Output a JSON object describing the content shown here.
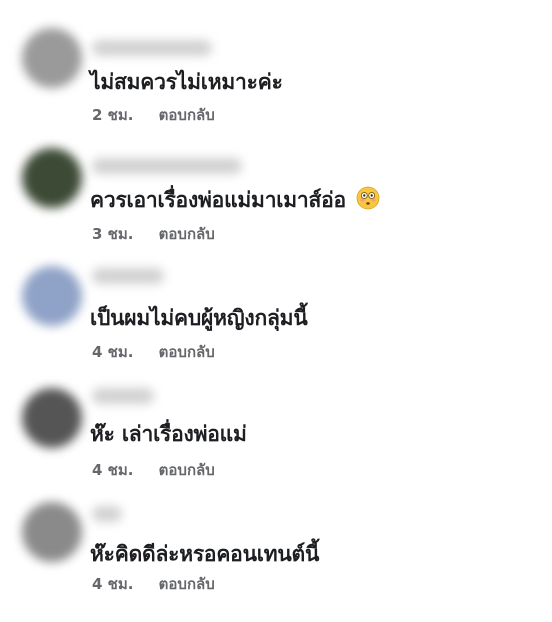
{
  "comments": [
    {
      "text": "ไม่สมควรไม่เหมาะค่ะ",
      "time": "2 ชม.",
      "reply": "ตอบกลับ",
      "avatar_color": "#9a9a9a"
    },
    {
      "text": "ควรเอาเรื่องพ่อแม่มาเมาส์อ่อ",
      "time": "3 ชม.",
      "reply": "ตอบกลับ",
      "avatar_color": "#3d4a36",
      "emoji": "flushed-face-icon"
    },
    {
      "text": "เป็นผมไม่คบผู้หญิงกลุ่มนี้",
      "time": "4 ชม.",
      "reply": "ตอบกลับ",
      "avatar_color": "#8fa2c7"
    },
    {
      "text": "ห๊ะ เล่าเรื่องพ่อแม่",
      "time": "4 ชม.",
      "reply": "ตอบกลับ",
      "avatar_color": "#555555"
    },
    {
      "text": "ห๊ะคิดดีล่ะหรอคอนเทนต์นี้",
      "time": "4 ชม.",
      "reply": "ตอบกลับ",
      "avatar_color": "#8a8a8a"
    }
  ]
}
